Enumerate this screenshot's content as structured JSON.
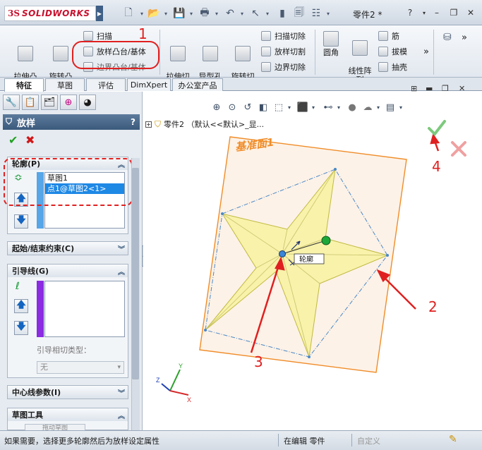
{
  "app": {
    "logo_text": "SOLIDWORKS",
    "logo_mark": "3S",
    "document_title": "零件2 *",
    "help": "?",
    "minimize": "–",
    "restore": "❐",
    "close": "✕"
  },
  "ribbon": {
    "extrude_boss": "拉伸凸\n台/基体",
    "revolve_boss": "旋转凸\n台/基体",
    "sweep": "扫描",
    "loft_boss": "放样凸台/基体",
    "boundary_boss": "边界凸台/基体",
    "extrude_cut": "拉伸切\n除",
    "hole_wizard": "异型孔\n向导",
    "revolve_cut": "旋转切\n除",
    "sweep_cut": "扫描切除",
    "loft_cut": "放样切割",
    "boundary_cut": "边界切除",
    "fillet": "圆角",
    "linear_pattern": "线性阵\n列",
    "rib": "筋",
    "draft": "拔模",
    "shell": "抽壳",
    "more": "»"
  },
  "tabs": [
    "特征",
    "草图",
    "评估",
    "DimXpert",
    "办公室产品"
  ],
  "panel": {
    "title": "放样",
    "help": "?",
    "ok": "✔",
    "cancel": "✖",
    "profiles_header": "轮廓(P)",
    "profiles": [
      "草图1",
      "点1@草图2<1>"
    ],
    "start_end_header": "起始/结束约束(C)",
    "guides_header": "引导线(G)",
    "guide_tangency_label": "引导相切类型：",
    "guide_tangency_value": "无",
    "centerline_header": "中心线参数(I)",
    "sketch_tools_header": "草图工具",
    "sketch_tools_button": "拖动草图"
  },
  "graphics": {
    "tree_label": "零件2 （默认<<默认>_显...",
    "plane_label": "基准面1",
    "callout_label": "轮廓",
    "axis_x": "X",
    "axis_y": "Y",
    "axis_z": "Z"
  },
  "annotations": {
    "n1": "1",
    "n2": "2",
    "n3": "3",
    "n4": "4"
  },
  "status": {
    "message": "如果需要，选择更多轮廓然后为放样设定属性",
    "editing": "在编辑 零件",
    "custom": "自定义"
  },
  "colors": {
    "annotation_red": "#e02020",
    "plane_orange": "#f08c28",
    "star_fill": "#f7f2a0",
    "selection_blue": "#1e88e5",
    "guide_purple": "#8b2be2"
  }
}
